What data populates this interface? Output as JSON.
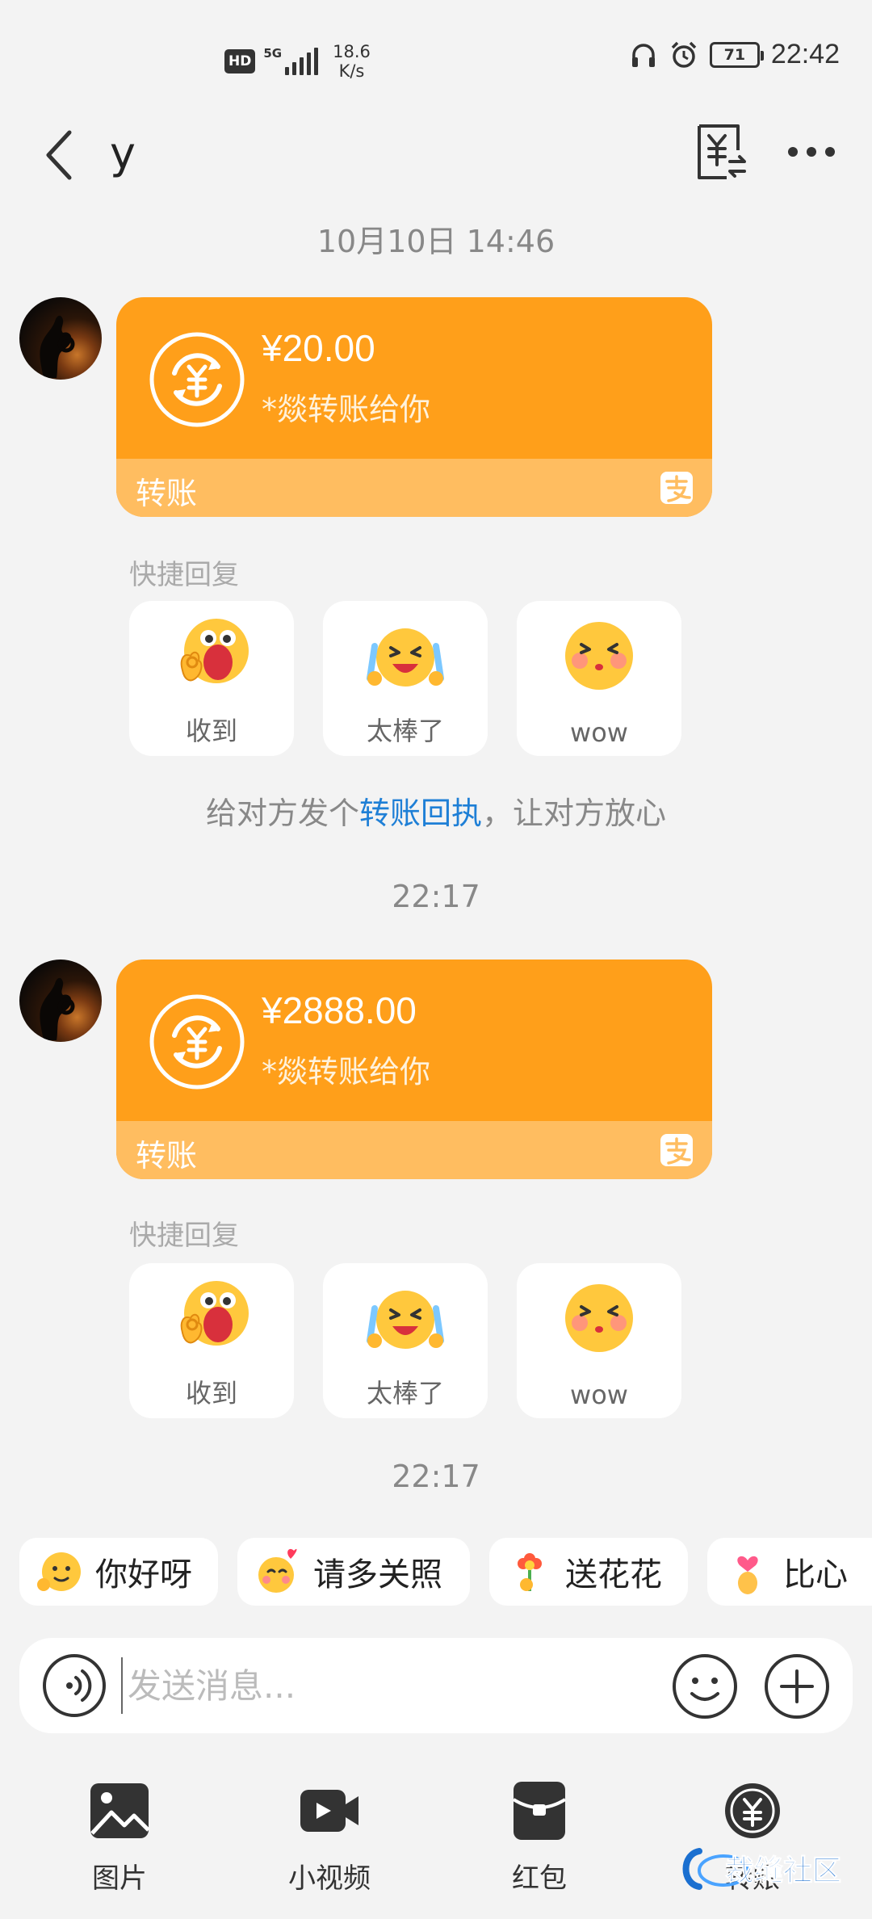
{
  "status_bar": {
    "network_badge": "HD",
    "network_type": "5G",
    "speed_value": "18.6",
    "speed_unit": "K/s",
    "battery": "71",
    "time": "22:42"
  },
  "header": {
    "contact_name": "y"
  },
  "messages": [
    {
      "timestamp": "10月10日 14:46",
      "amount": "¥20.00",
      "description": "*燚转账给你",
      "card_label": "转账"
    },
    {
      "timestamp": "22:17",
      "amount": "¥2888.00",
      "description": "*燚转账给你",
      "card_label": "转账"
    }
  ],
  "quick_reply": {
    "title": "快捷回复",
    "options": [
      "收到",
      "太棒了",
      "wow"
    ]
  },
  "receipt_hint": {
    "before": "给对方发个",
    "link": "转账回执",
    "after": "，让对方放心"
  },
  "last_timestamp": "22:17",
  "suggestion_chips": [
    "你好呀",
    "请多关照",
    "送花花",
    "比心"
  ],
  "input": {
    "placeholder": "发送消息..."
  },
  "toolbar": [
    "图片",
    "小视频",
    "红包",
    "转账"
  ],
  "watermark_text": "裁缝社区",
  "colors": {
    "card_orange": "#ff9f1a",
    "card_footer": "#ffbd60",
    "link_blue": "#1e7fd6",
    "background": "#f3f3f3"
  }
}
